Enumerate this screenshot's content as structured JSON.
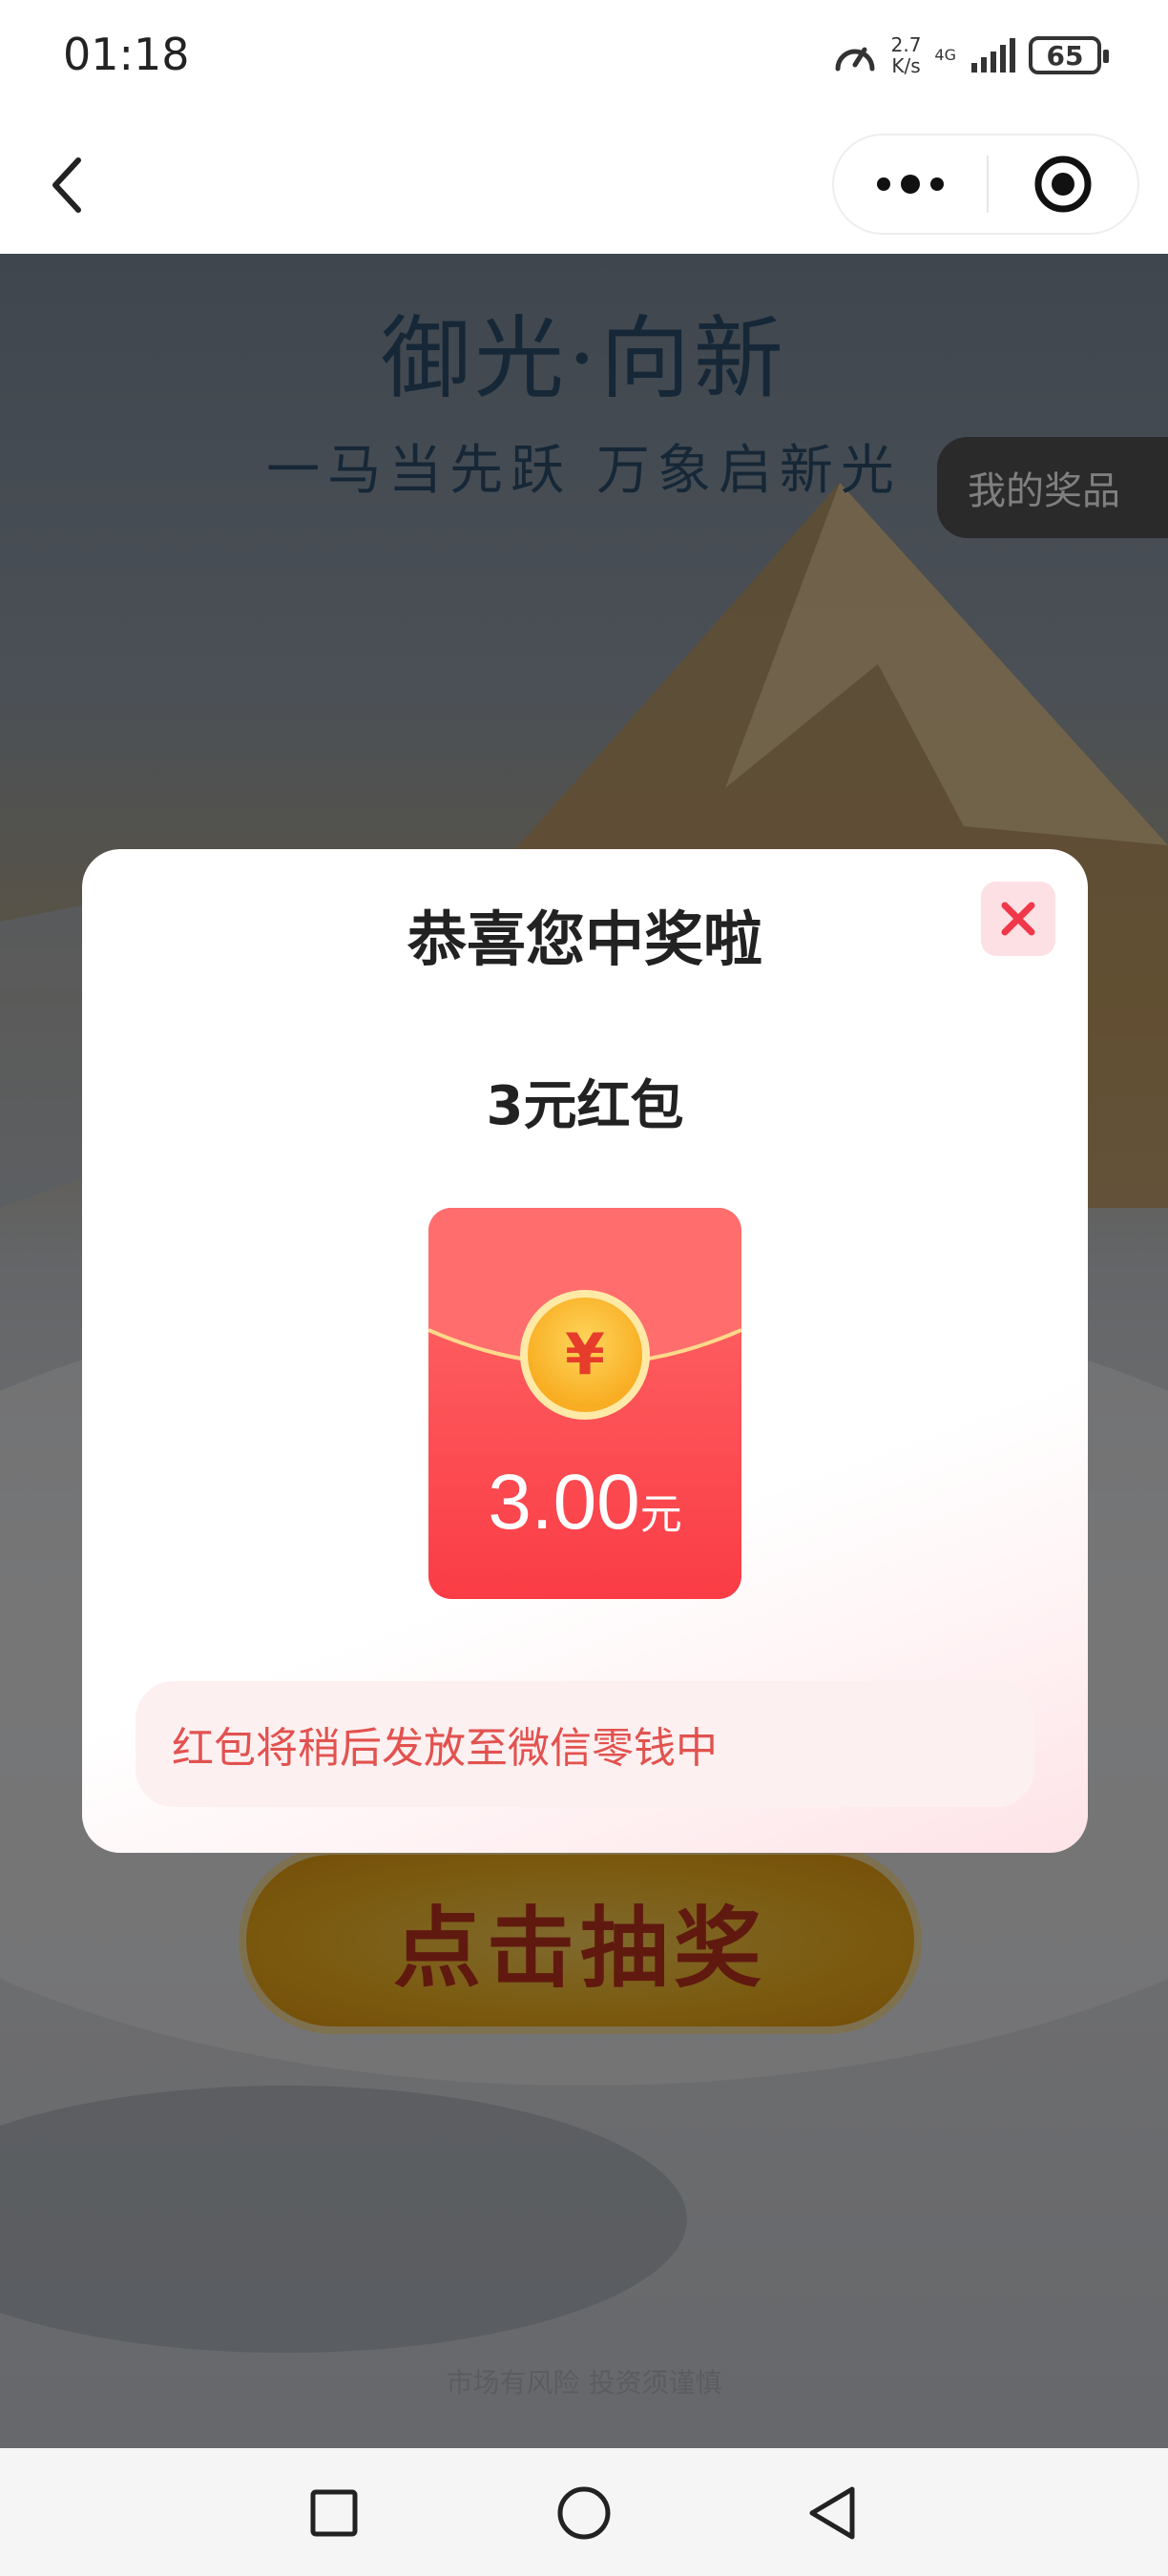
{
  "status_bar": {
    "time": "01:18",
    "speed_value": "2.7",
    "speed_unit": "K/s",
    "network": "4G",
    "battery": "65"
  },
  "nav": {
    "back_icon": "chevron-left-icon",
    "more_icon": "more-dots-icon",
    "target_icon": "record-target-icon"
  },
  "background": {
    "title": "御光·向新",
    "subtitle": "一马当先跃 万象启新光",
    "my_prizes": "我的奖品",
    "draw_button": "点击抽奖",
    "disclaimer": "市场有风险 投资须谨慎"
  },
  "modal": {
    "title": "恭喜您中奖啦",
    "prize_name": "3元红包",
    "coin_symbol": "¥",
    "amount": "3.00",
    "amount_unit": "元",
    "notice": "红包将稍后发放至微信零钱中",
    "close_icon": "close-icon"
  },
  "colors": {
    "accent_red": "#fa3c45",
    "notice_text": "#e2524f",
    "notice_bg": "#fdf0f1",
    "coin_gold": "#f8ad22"
  }
}
